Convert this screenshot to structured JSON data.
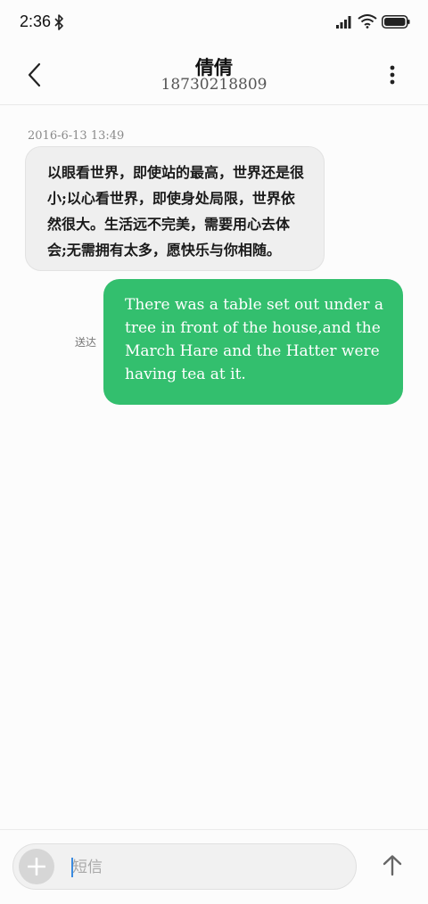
{
  "status_bar": {
    "time": "2:36"
  },
  "header": {
    "contact_name": "倩倩",
    "phone_number": "18730218809"
  },
  "conversation": {
    "timestamp": "2016-6-13 13:49",
    "received_message": "以眼看世界，即使站的最高，世界还是很小;以心看世界，即使身处局限，世界依然很大。生活远不完美，需要用心去体会;无需拥有太多，愿快乐与你相随。",
    "sent_message": "There was a table set out under a tree in front of the house,and the March Hare and the Hatter were having tea at it.",
    "sent_status": "送达"
  },
  "composer": {
    "placeholder": "短信"
  },
  "icons": {
    "status": [
      "bluetooth-icon",
      "signal-icon",
      "wifi-icon",
      "battery-icon"
    ],
    "header": [
      "back-arrow-icon",
      "more-vertical-icon"
    ],
    "composer": [
      "plus-icon",
      "send-arrow-up-icon"
    ]
  },
  "colors": {
    "sent_bubble": "#33bf6e",
    "received_bubble": "#efefef",
    "cursor": "#3a8be0"
  }
}
